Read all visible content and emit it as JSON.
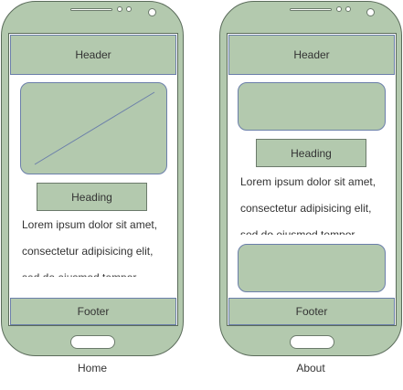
{
  "screens": [
    {
      "caption": "Home",
      "header": "Header",
      "heading": "Heading",
      "paragraph_lines": [
        "Lorem ipsum dolor sit amet,",
        "consectetur adipisicing elit,",
        "sed do eiusmod tempor"
      ],
      "footer": "Footer"
    },
    {
      "caption": "About",
      "header": "Header",
      "heading": "Heading",
      "paragraph_lines": [
        "Lorem ipsum dolor sit amet,",
        "consectetur adipisicing elit,",
        "sed do eiusmod tempor"
      ],
      "footer": "Footer"
    }
  ],
  "colors": {
    "phone_fill": "#b3c9ae",
    "screen_fill": "#ffffff",
    "block_border": "#6b7faa"
  }
}
